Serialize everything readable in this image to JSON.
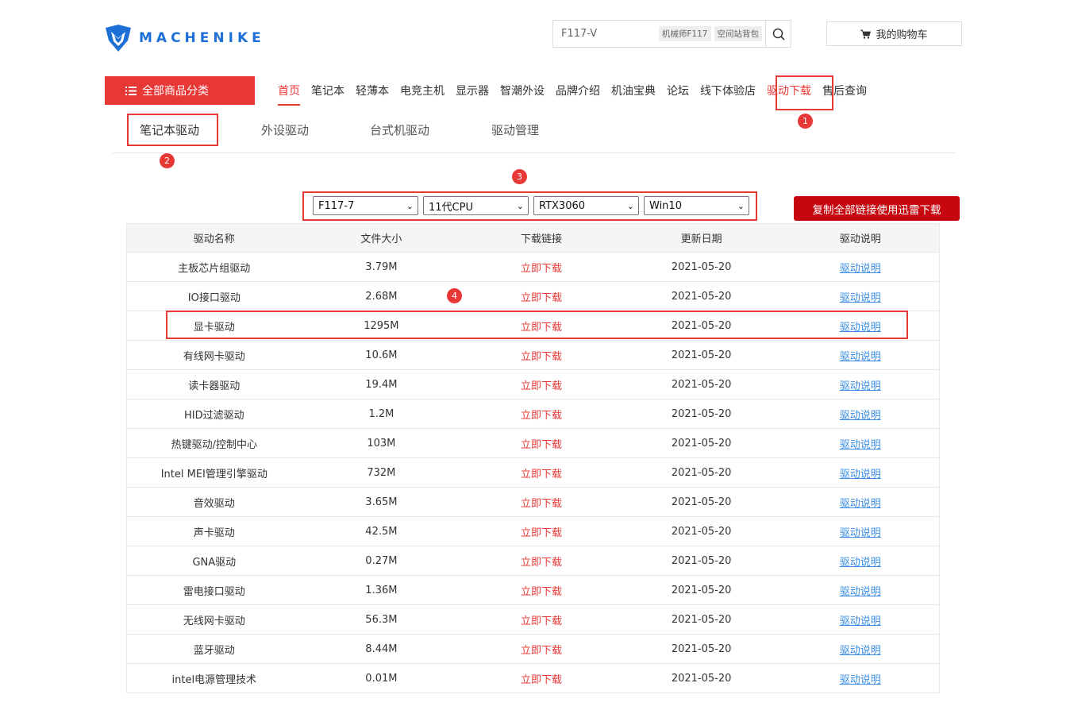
{
  "header": {
    "logo_text": "MACHENIKE",
    "search": {
      "value": "F117-V",
      "hot_tags": [
        "机械师F117",
        "空间站背包"
      ]
    },
    "cart_label": "我的购物车"
  },
  "nav": {
    "all_categories": "全部商品分类",
    "items": [
      "首页",
      "笔记本",
      "轻薄本",
      "电竞主机",
      "显示器",
      "智潮外设",
      "品牌介绍",
      "机油宝典",
      "论坛",
      "线下体验店",
      "驱动下载",
      "售后查询"
    ]
  },
  "subtabs": [
    "笔记本驱动",
    "外设驱动",
    "台式机驱动",
    "驱动管理"
  ],
  "filters": [
    "F117-7",
    "11代CPU",
    "RTX3060",
    "Win10"
  ],
  "copy_button": "复制全部链接使用迅雷下载",
  "annotations": [
    "1",
    "2",
    "3",
    "4"
  ],
  "table": {
    "headers": [
      "驱动名称",
      "文件大小",
      "下载链接",
      "更新日期",
      "驱动说明"
    ],
    "download_label": "立即下载",
    "doc_label": "驱动说明",
    "rows": [
      {
        "name": "主板芯片组驱动",
        "size": "3.79M",
        "date": "2021-05-20"
      },
      {
        "name": "IO接口驱动",
        "size": "2.68M",
        "date": "2021-05-20"
      },
      {
        "name": "显卡驱动",
        "size": "1295M",
        "date": "2021-05-20"
      },
      {
        "name": "有线网卡驱动",
        "size": "10.6M",
        "date": "2021-05-20"
      },
      {
        "name": "读卡器驱动",
        "size": "19.4M",
        "date": "2021-05-20"
      },
      {
        "name": "HID过滤驱动",
        "size": "1.2M",
        "date": "2021-05-20"
      },
      {
        "name": "热键驱动/控制中心",
        "size": "103M",
        "date": "2021-05-20"
      },
      {
        "name": "Intel MEI管理引擎驱动",
        "size": "732M",
        "date": "2021-05-20"
      },
      {
        "name": "音效驱动",
        "size": "3.65M",
        "date": "2021-05-20"
      },
      {
        "name": "声卡驱动",
        "size": "42.5M",
        "date": "2021-05-20"
      },
      {
        "name": "GNA驱动",
        "size": "0.27M",
        "date": "2021-05-20"
      },
      {
        "name": "雷电接口驱动",
        "size": "1.36M",
        "date": "2021-05-20"
      },
      {
        "name": "无线网卡驱动",
        "size": "56.3M",
        "date": "2021-05-20"
      },
      {
        "name": "蓝牙驱动",
        "size": "8.44M",
        "date": "2021-05-20"
      },
      {
        "name": "intel电源管理技术",
        "size": "0.01M",
        "date": "2021-05-20"
      }
    ]
  },
  "colors": {
    "brand_red": "#e83836",
    "button_dark_red": "#c7070f",
    "link_blue": "#3a8ee6",
    "logo_blue": "#1d6fd6"
  }
}
